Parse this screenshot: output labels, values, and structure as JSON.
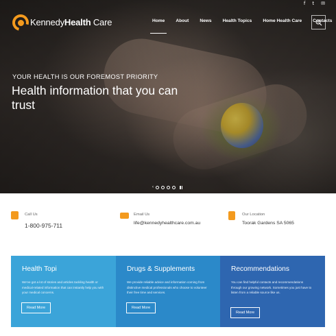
{
  "social": {
    "icons": [
      "facebook-icon",
      "twitter-icon",
      "email-icon"
    ],
    "glyphs": [
      "f",
      "t",
      "✉"
    ]
  },
  "brand": {
    "name_part1": "Kennedy",
    "name_part2": "Health",
    "name_part3": " Care",
    "accent_color": "#f39a1e"
  },
  "nav": {
    "items": [
      {
        "label": "Home",
        "active": true
      },
      {
        "label": "About",
        "active": false
      },
      {
        "label": "News",
        "active": false
      },
      {
        "label": "Health Topics",
        "active": false
      },
      {
        "label": "Home Health Care",
        "active": false
      },
      {
        "label": "Contacts",
        "active": false
      }
    ],
    "search_icon": "zoom-icon"
  },
  "hero": {
    "kicker": "YOUR HEALTH IS OUR FOREMOST PRIORITY",
    "headline": "Health information that you can trust",
    "slider": {
      "prev_glyph": "‹",
      "dots": 4,
      "pause_icon": "pause-icon"
    }
  },
  "contact": {
    "items": [
      {
        "label": "Call Us",
        "value": "1-800-975-711",
        "icon": "phone-icon"
      },
      {
        "label": "Email Us",
        "value": "life@kennedyhealthcare.com.au",
        "icon": "laptop-icon"
      },
      {
        "label": "Our Location",
        "value": "Toorak Gardens SA 5065",
        "icon": "location-icon"
      }
    ]
  },
  "cards": [
    {
      "title": "Health Topi",
      "text": "We've got a lot of stories and articles tackling health or medical-related information that can instantly help you with your medical concerns.",
      "button": "Read More",
      "color": "#3ba4d9"
    },
    {
      "title": "Drugs & Supplements",
      "text": "We provide reliable advice and information coming from distinctive medical professionals who choose to volunteer their free time and services.",
      "button": "Read More",
      "color": "#2b89c9"
    },
    {
      "title": "Recommendations",
      "text": "You can find helpful contacts and recommendations through our growing network. Sometimes you just have to listen from a reliable source like us.",
      "button": "Read More",
      "color": "#2e66b0"
    }
  ]
}
